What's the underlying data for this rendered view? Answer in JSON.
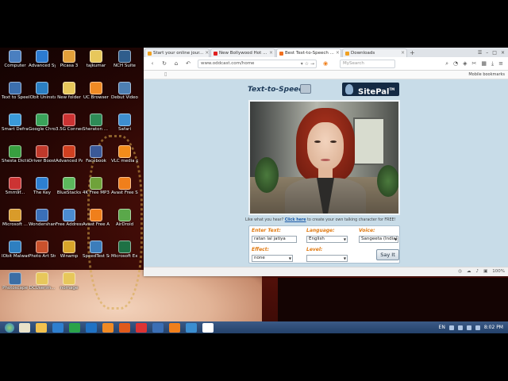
{
  "desktop": {
    "icons": [
      {
        "label": "Computer",
        "color": "#4a7fc0"
      },
      {
        "label": "Advanced SystemCare 9",
        "color": "#2c7bd1"
      },
      {
        "label": "Picasa 3",
        "color": "#e3a03a"
      },
      {
        "label": "tajkumar",
        "color": "#e7c75b"
      },
      {
        "label": "NCH Suite",
        "color": "#2f5d8c"
      },
      {
        "label": "Text to Spee...",
        "color": "#3c6fae"
      },
      {
        "label": "IObit Uninstaller",
        "color": "#2b7fc3"
      },
      {
        "label": "New folder",
        "color": "#e7c75b"
      },
      {
        "label": "UC Browser",
        "color": "#f08a24"
      },
      {
        "label": "Debut Video Capture S...",
        "color": "#4d7fb3"
      },
      {
        "label": "Smart Defrag 5",
        "color": "#3a9ad9"
      },
      {
        "label": "Google Chrome",
        "color": "#3aa35a"
      },
      {
        "label": "3.5G Connect Mo...",
        "color": "#cc3333"
      },
      {
        "label": "Sheraton ... Mohali...",
        "color": "#2e8b57"
      },
      {
        "label": "Safari",
        "color": "#3e8ed0"
      },
      {
        "label": "Shesta Dictionary",
        "color": "#38a040"
      },
      {
        "label": "Driver Booster3",
        "color": "#c0392b"
      },
      {
        "label": "Advanced Patcher Pr...",
        "color": "#d04020"
      },
      {
        "label": "Facebook",
        "color": "#3b5998"
      },
      {
        "label": "VLC media player",
        "color": "#f28c1a"
      },
      {
        "label": "5mm9f...",
        "color": "#c33"
      },
      {
        "label": "The Key",
        "color": "#2d7fd1"
      },
      {
        "label": "BlueStacks",
        "color": "#5cb85c"
      },
      {
        "label": "4K Free MP3 Cutter",
        "color": "#6fa23a"
      },
      {
        "label": "Avast Free Selecto...",
        "color": "#f07f1b"
      },
      {
        "label": "Microsoft ...",
        "color": "#d99b2a"
      },
      {
        "label": "Wondershare Video Editor",
        "color": "#3a6fb8"
      },
      {
        "label": "Free Address Book",
        "color": "#4b8bd0"
      },
      {
        "label": "Avast Free Antivirus",
        "color": "#f07f1b"
      },
      {
        "label": "AirDroid",
        "color": "#5aa84a"
      },
      {
        "label": "IObit Malware...",
        "color": "#2e7fc0"
      },
      {
        "label": "Photo Art Studio",
        "color": "#c9512c"
      },
      {
        "label": "Winamp",
        "color": "#d8a42a"
      },
      {
        "label": "SpeedTest Search",
        "color": "#3c7dbb"
      },
      {
        "label": "Microsoft Ex...",
        "color": "#1e7145"
      },
      {
        "label": "Photoscape",
        "color": "#3b6ea5"
      },
      {
        "label": "DCUserim...",
        "color": "#e7c75b"
      },
      {
        "label": "nomage",
        "color": "#e7c75b"
      }
    ]
  },
  "browser": {
    "tabs": [
      {
        "label": "Start your online jour...",
        "color": "#f0a020",
        "active": false
      },
      {
        "label": "New Bollywood Hot ...",
        "color": "#e02020",
        "active": false
      },
      {
        "label": "Best Text-to-Speech ...",
        "color": "#f07020",
        "active": true
      },
      {
        "label": "Downloads",
        "color": "#f0a020",
        "active": false
      }
    ],
    "new_tab": "+",
    "url": "www.oddcast.com/home",
    "search_placeholder": "MySearch",
    "bookmarks_label": "Mobile bookmarks",
    "zoom": "100%"
  },
  "sitepal": {
    "title": "Text-to-Speech",
    "logo": "SitePal",
    "trademark": "TM",
    "promo_prefix": "Like what you hear? ",
    "promo_link": "Click here",
    "promo_suffix": " to create your own talking character for FREE!",
    "enter_text_label": "Enter Text:",
    "enter_text_value": "ratan lal jatiya",
    "language_label": "Language:",
    "language_value": "English",
    "voice_label": "Voice:",
    "voice_value": "Sangeeta (India)",
    "effect_label": "Effect:",
    "effect_value": "none",
    "level_label": "Level:",
    "level_value": "",
    "say_it_label": "Say It"
  },
  "taskbar": {
    "apps": [
      {
        "color": "#e9e2c9"
      },
      {
        "color": "#f2c14e"
      },
      {
        "color": "#2e7fcf"
      },
      {
        "color": "#2aa34a"
      },
      {
        "color": "#1f72c4"
      },
      {
        "color": "#f08a24"
      },
      {
        "color": "#e05a1b"
      },
      {
        "color": "#d33"
      },
      {
        "color": "#3b6fb5"
      },
      {
        "color": "#f07f1b"
      },
      {
        "color": "#3b8ed0"
      },
      {
        "color": "#fff"
      }
    ],
    "language": "EN",
    "time": "8:02 PM"
  }
}
